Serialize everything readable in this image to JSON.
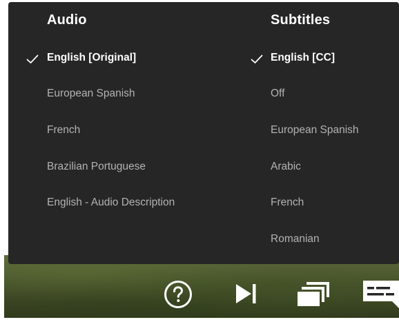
{
  "audio": {
    "header": "Audio",
    "options": [
      {
        "label": "English [Original]",
        "selected": true
      },
      {
        "label": "European Spanish",
        "selected": false
      },
      {
        "label": "French",
        "selected": false
      },
      {
        "label": "Brazilian Portuguese",
        "selected": false
      },
      {
        "label": "English - Audio Description",
        "selected": false
      }
    ]
  },
  "subtitles": {
    "header": "Subtitles",
    "options": [
      {
        "label": "English [CC]",
        "selected": true
      },
      {
        "label": "Off",
        "selected": false
      },
      {
        "label": "European Spanish",
        "selected": false
      },
      {
        "label": "Arabic",
        "selected": false
      },
      {
        "label": "French",
        "selected": false
      },
      {
        "label": "Romanian",
        "selected": false
      }
    ]
  },
  "controls": {
    "icons": [
      "help-icon",
      "next-episode-icon",
      "episodes-icon",
      "subtitles-audio-icon"
    ]
  },
  "colors": {
    "panel_bg": "#262626",
    "selected_text": "#ffffff",
    "unselected_text": "#b3b3b3"
  }
}
